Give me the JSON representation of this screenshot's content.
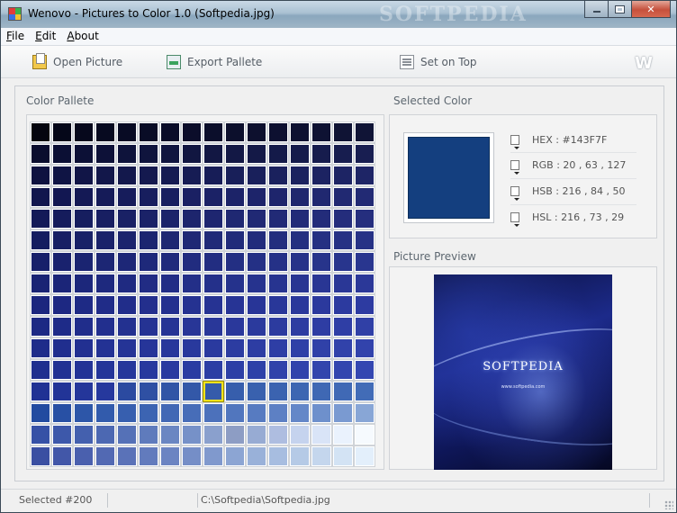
{
  "window": {
    "title": "Wenovo - Pictures to Color 1.0 (Softpedia.jpg)",
    "watermark": "SOFTPEDIA"
  },
  "menu": [
    {
      "key": "F",
      "rest": "ile"
    },
    {
      "key": "E",
      "rest": "dit"
    },
    {
      "key": "A",
      "rest": "bout"
    }
  ],
  "toolbar": {
    "open_label": "Open Picture",
    "export_label": "Export Pallete",
    "top_label": "Set on Top",
    "logo": "W"
  },
  "palette": {
    "title": "Color Pallete",
    "columns": 16,
    "rows": 16,
    "selected_index": 200,
    "colors": [
      "#04050f",
      "#050719",
      "#06081c",
      "#070a20",
      "#080b24",
      "#090c26",
      "#0a0c28",
      "#0b0d2a",
      "#0b0e2b",
      "#0c0f2c",
      "#0d102e",
      "#0d1030",
      "#0e1131",
      "#0e1233",
      "#0f1334",
      "#101436",
      "#0a0d2e",
      "#0b0f34",
      "#0c1036",
      "#0d1138",
      "#0e133b",
      "#0f143d",
      "#10153f",
      "#111641",
      "#121743",
      "#131845",
      "#141947",
      "#141a49",
      "#151b4b",
      "#161c4d",
      "#171d4f",
      "#181e51",
      "#0e1240",
      "#0f1444",
      "#111547",
      "#12174a",
      "#13184c",
      "#14194f",
      "#151b52",
      "#161c54",
      "#171d57",
      "#181f59",
      "#19205b",
      "#1a215d",
      "#1b225f",
      "#1c2362",
      "#1d2464",
      "#1e2566",
      "#11164e",
      "#121752",
      "#141955",
      "#151b58",
      "#161c5b",
      "#171e5e",
      "#181f60",
      "#1a2063",
      "#1b2266",
      "#1c2368",
      "#1d246a",
      "#1e256c",
      "#1f276e",
      "#202870",
      "#212972",
      "#222a74",
      "#131a58",
      "#151c5c",
      "#161e5f",
      "#181f62",
      "#192165",
      "#1a2268",
      "#1b236a",
      "#1d256d",
      "#1e2670",
      "#1f2872",
      "#202974",
      "#212a76",
      "#222b78",
      "#232c7a",
      "#242d7c",
      "#252e7e",
      "#151d60",
      "#171f64",
      "#182167",
      "#1a226a",
      "#1b246d",
      "#1c2570",
      "#1e2772",
      "#1f2875",
      "#202a78",
      "#212b7a",
      "#222c7c",
      "#232e7e",
      "#242f80",
      "#253082",
      "#263184",
      "#273286",
      "#17206a",
      "#19226e",
      "#1a2471",
      "#1c2674",
      "#1d2777",
      "#1e297a",
      "#202a7c",
      "#212c7f",
      "#222d81",
      "#232f83",
      "#243085",
      "#253187",
      "#263289",
      "#27348b",
      "#28358d",
      "#29368f",
      "#192374",
      "#1b2578",
      "#1c277b",
      "#1e297e",
      "#1f2a81",
      "#212c84",
      "#222d86",
      "#232f88",
      "#24308a",
      "#25328c",
      "#26338e",
      "#273490",
      "#283592",
      "#293694",
      "#2a3796",
      "#2b3898",
      "#1b267e",
      "#1d2882",
      "#1e2a85",
      "#202c88",
      "#212d8a",
      "#232f8d",
      "#24308f",
      "#253291",
      "#263393",
      "#273495",
      "#283597",
      "#293799",
      "#2a389b",
      "#2b399d",
      "#2c3a9f",
      "#2d3ba1",
      "#1c2984",
      "#1e2b88",
      "#202d8b",
      "#222f8e",
      "#233190",
      "#253393",
      "#263495",
      "#283697",
      "#293799",
      "#2a389b",
      "#2b3a9d",
      "#2c3b9f",
      "#2d3ca1",
      "#2e3da3",
      "#2f3ea5",
      "#3040a6",
      "#1e2c8a",
      "#202e8e",
      "#223091",
      "#233294",
      "#253496",
      "#263599",
      "#28379b",
      "#29399d",
      "#2a3a9f",
      "#2c3ca1",
      "#2d3da3",
      "#2e3ea5",
      "#2f40a7",
      "#3041a8",
      "#3142aa",
      "#3243ac",
      "#1f2f8f",
      "#213193",
      "#233396",
      "#243599",
      "#26379b",
      "#28399e",
      "#293aa0",
      "#2a3ca2",
      "#2c3ea4",
      "#2d3fa6",
      "#2e41a8",
      "#3042aa",
      "#3143ac",
      "#3245ad",
      "#3346af",
      "#3447b1",
      "#203294",
      "#223497",
      "#24369a",
      "#26389d",
      "#2b4aa0",
      "#2f50a3",
      "#3155a6",
      "#3358a8",
      "#355baa",
      "#375eac",
      "#3961ae",
      "#3b63b0",
      "#3d66b2",
      "#3f68b4",
      "#4069b5",
      "#426cb7",
      "#224ba0",
      "#2850a4",
      "#2d56a8",
      "#325bac",
      "#375faf",
      "#3c64b2",
      "#4268b5",
      "#476db8",
      "#4c71bb",
      "#5176be",
      "#577bc1",
      "#5d80c4",
      "#6487c8",
      "#6e90cc",
      "#7a9ad1",
      "#88a6d6",
      "#3651a6",
      "#3d58aa",
      "#4460ae",
      "#4c68b2",
      "#5571b7",
      "#5f7bbc",
      "#6a86c2",
      "#7691c8",
      "#8aa0cd",
      "#8d9dc4",
      "#97abd3",
      "#aebde0",
      "#c5d3ee",
      "#d9e4f7",
      "#eaf2fd",
      "#f6fafe",
      "#3a4fa2",
      "#4257a8",
      "#4a60ae",
      "#5269b3",
      "#5a72b8",
      "#627bbd",
      "#6b84c2",
      "#758ec7",
      "#8099cd",
      "#8ca5d3",
      "#99b1d9",
      "#a7bde0",
      "#b5cae6",
      "#c4d6ed",
      "#d3e3f4",
      "#e3effb"
    ]
  },
  "selected_color": {
    "title": "Selected Color",
    "swatch_color": "#143F7F",
    "hex_label": "HEX :",
    "hex_value": "#143F7F",
    "rgb_label": "RGB :",
    "rgb_value": "20 , 63 , 127",
    "hsb_label": "HSB :",
    "hsb_value": "216 , 84 , 50",
    "hsl_label": "HSL :",
    "hsl_value": "216 , 73 , 29"
  },
  "preview": {
    "title": "Picture Preview",
    "brand": "SOFTPEDIA",
    "url": "www.softpedia.com"
  },
  "status": {
    "selected": "Selected #200",
    "path": "C:\\Softpedia\\Softpedia.jpg"
  }
}
